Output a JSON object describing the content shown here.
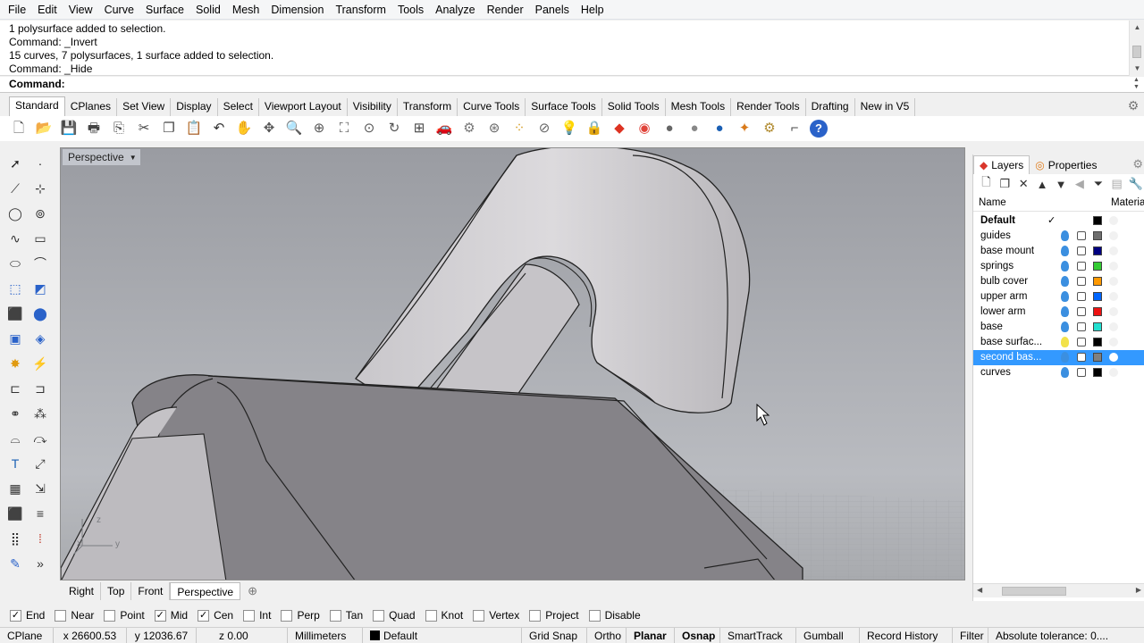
{
  "menu": [
    "File",
    "Edit",
    "View",
    "Curve",
    "Surface",
    "Solid",
    "Mesh",
    "Dimension",
    "Transform",
    "Tools",
    "Analyze",
    "Render",
    "Panels",
    "Help"
  ],
  "history": [
    "1 polysurface added to selection.",
    "Command: _Invert",
    "15 curves, 7 polysurfaces, 1 surface added to selection.",
    "Command: _Hide"
  ],
  "command": {
    "label": "Command:",
    "value": ""
  },
  "toolbar_tabs": [
    {
      "label": "Standard",
      "active": true
    },
    {
      "label": "CPlanes"
    },
    {
      "label": "Set View"
    },
    {
      "label": "Display"
    },
    {
      "label": "Select"
    },
    {
      "label": "Viewport Layout"
    },
    {
      "label": "Visibility"
    },
    {
      "label": "Transform"
    },
    {
      "label": "Curve Tools"
    },
    {
      "label": "Surface Tools"
    },
    {
      "label": "Solid Tools"
    },
    {
      "label": "Mesh Tools"
    },
    {
      "label": "Render Tools"
    },
    {
      "label": "Drafting"
    },
    {
      "label": "New in V5"
    }
  ],
  "toolbar_icons": [
    {
      "name": "new-file-icon",
      "glyph": "🗋",
      "color": "#555555"
    },
    {
      "name": "open-folder-icon",
      "glyph": "📂",
      "color": "#d9a520"
    },
    {
      "name": "save-icon",
      "glyph": "💾",
      "color": "#4a4a4a"
    },
    {
      "name": "print-icon",
      "glyph": "🖶",
      "color": "#444444"
    },
    {
      "name": "copy-to-clipboard-icon",
      "glyph": "⎘",
      "color": "#444444"
    },
    {
      "name": "cut-icon",
      "glyph": "✂",
      "color": "#444444"
    },
    {
      "name": "copy-icon",
      "glyph": "❐",
      "color": "#444444"
    },
    {
      "name": "paste-icon",
      "glyph": "📋",
      "color": "#c9a24b"
    },
    {
      "name": "undo-icon",
      "glyph": "↶",
      "color": "#333333"
    },
    {
      "name": "pan-hand-icon",
      "glyph": "✋",
      "color": "#555555"
    },
    {
      "name": "move-view-icon",
      "glyph": "✥",
      "color": "#555555"
    },
    {
      "name": "zoom-icon",
      "glyph": "🔍",
      "color": "#555555"
    },
    {
      "name": "zoom-window-icon",
      "glyph": "⊕",
      "color": "#555555"
    },
    {
      "name": "zoom-extents-icon",
      "glyph": "⛶",
      "color": "#555555"
    },
    {
      "name": "zoom-selected-icon",
      "glyph": "⊙",
      "color": "#555555"
    },
    {
      "name": "rotate-view-icon",
      "glyph": "↻",
      "color": "#555555"
    },
    {
      "name": "four-viewports-icon",
      "glyph": "⊞",
      "color": "#444444"
    },
    {
      "name": "car-icon",
      "glyph": "🚗",
      "color": "#cc2222"
    },
    {
      "name": "grid-snap-icon",
      "glyph": "⚙",
      "color": "#777777"
    },
    {
      "name": "select-points-icon",
      "glyph": "⊛",
      "color": "#666666"
    },
    {
      "name": "points-icon",
      "glyph": "⁘",
      "color": "#d49b1f"
    },
    {
      "name": "hide-objects-icon",
      "glyph": "⊘",
      "color": "#666666"
    },
    {
      "name": "light-bulb-icon",
      "glyph": "💡",
      "color": "#777777"
    },
    {
      "name": "lock-icon",
      "glyph": "🔒",
      "color": "#555555"
    },
    {
      "name": "layer-icon",
      "glyph": "◆",
      "color": "#dd3322"
    },
    {
      "name": "color-wheel-icon",
      "glyph": "◉",
      "color": "#e0443a"
    },
    {
      "name": "shaded-sphere-icon",
      "glyph": "●",
      "color": "#666666"
    },
    {
      "name": "rendered-sphere-icon",
      "glyph": "●",
      "color": "#888888"
    },
    {
      "name": "material-sphere-icon",
      "glyph": "●",
      "color": "#1a5fb4"
    },
    {
      "name": "render-light-icon",
      "glyph": "✦",
      "color": "#d97a1a"
    },
    {
      "name": "options-gear-icon",
      "glyph": "⚙",
      "color": "#b08a2e"
    },
    {
      "name": "dimension-icon",
      "glyph": "⌐",
      "color": "#444444"
    },
    {
      "name": "help-icon",
      "glyph": "?",
      "color": "#2a62c9"
    }
  ],
  "viewport": {
    "name": "Perspective",
    "axis_z": "z",
    "axis_y": "y",
    "axis_x": "x"
  },
  "viewport_tabs": [
    {
      "label": "Right"
    },
    {
      "label": "Top"
    },
    {
      "label": "Front"
    },
    {
      "label": "Perspective",
      "active": true
    }
  ],
  "panel": {
    "tabs": [
      {
        "label": "Layers",
        "active": true
      },
      {
        "label": "Properties"
      }
    ],
    "col_name": "Name",
    "col_material": "Material",
    "layers": [
      {
        "name": "Default",
        "color": "#000000",
        "default": true,
        "check": "✓"
      },
      {
        "name": "guides",
        "color": "#6e6e6e"
      },
      {
        "name": "base mount",
        "color": "#000080"
      },
      {
        "name": "springs",
        "color": "#33cc33"
      },
      {
        "name": "bulb cover",
        "color": "#ff9900"
      },
      {
        "name": "upper arm",
        "color": "#0066ff"
      },
      {
        "name": "lower arm",
        "color": "#ee1111"
      },
      {
        "name": "base",
        "color": "#22e0d0"
      },
      {
        "name": "base surfac...",
        "color": "#000000",
        "bulb_off": true
      },
      {
        "name": "second bas...",
        "color": "#808080",
        "selected": true
      },
      {
        "name": "curves",
        "color": "#000000"
      }
    ]
  },
  "osnaps": [
    {
      "label": "End",
      "checked": true
    },
    {
      "label": "Near",
      "checked": false
    },
    {
      "label": "Point",
      "checked": false
    },
    {
      "label": "Mid",
      "checked": true
    },
    {
      "label": "Cen",
      "checked": true
    },
    {
      "label": "Int",
      "checked": false
    },
    {
      "label": "Perp",
      "checked": false
    },
    {
      "label": "Tan",
      "checked": false
    },
    {
      "label": "Quad",
      "checked": false
    },
    {
      "label": "Knot",
      "checked": false
    },
    {
      "label": "Vertex",
      "checked": false
    },
    {
      "label": "Project",
      "checked": false
    },
    {
      "label": "Disable",
      "checked": false
    }
  ],
  "status": {
    "cplane": "CPlane",
    "x": "x 26600.53",
    "y": "y 12036.67",
    "z": "z 0.00",
    "units": "Millimeters",
    "layer": "Default",
    "grid_snap": "Grid Snap",
    "ortho": "Ortho",
    "planar": "Planar",
    "osnap": "Osnap",
    "smarttrack": "SmartTrack",
    "gumball": "Gumball",
    "record_history": "Record History",
    "filter": "Filter",
    "tolerance": "Absolute tolerance: 0...."
  }
}
